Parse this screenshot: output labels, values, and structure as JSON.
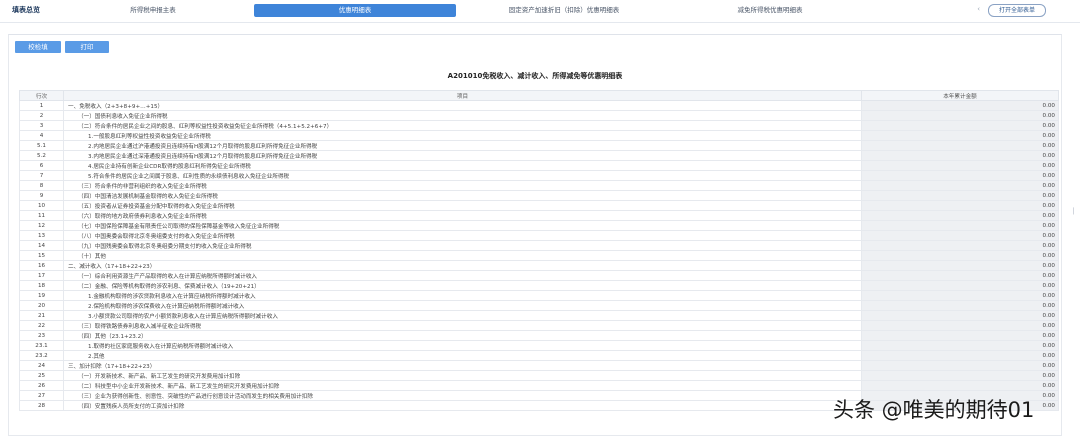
{
  "header": {
    "title": "填表总览",
    "tabs": [
      {
        "label": "所得税申报主表",
        "active": false
      },
      {
        "label": "优惠明细表",
        "active": true
      },
      {
        "label": "固定资产加速折旧（扣除）优惠明细表",
        "active": false
      },
      {
        "label": "减免所得税优惠明细表",
        "active": false
      }
    ],
    "scroll_arrow": "‹",
    "open_all_label": "打开全部表单"
  },
  "toolbar": {
    "check_label": "校检填",
    "print_label": "打印"
  },
  "form": {
    "title": "A201010免税收入、减计收入、所得减免等优惠明细表",
    "columns": {
      "row_no": "行次",
      "item": "项目",
      "amount": "本年累计金额"
    },
    "rows": [
      {
        "no": "1",
        "item": "一、免税收入（2+3+8+9+…+15）",
        "amount": "0.00"
      },
      {
        "no": "2",
        "item": "（一）国债利息收入免征企业所得税",
        "amount": "0.00"
      },
      {
        "no": "3",
        "item": "（二）符合条件的居民企业之间的股息、红利等权益性投资收益免征企业所得税（4+5.1+5.2+6+7）",
        "amount": "0.00"
      },
      {
        "no": "4",
        "item": "1.一般股息红利等权益性投资收益免征企业所得税",
        "amount": "0.00"
      },
      {
        "no": "5.1",
        "item": "2.内地居民企业通过沪港通投资且连续持有H股满12个月取得的股息红利所得免征企业所得税",
        "amount": "0.00"
      },
      {
        "no": "5.2",
        "item": "3.内地居民企业通过深港通投资且连续持有H股满12个月取得的股息红利所得免征企业所得税",
        "amount": "0.00"
      },
      {
        "no": "6",
        "item": "4.居民企业持有创新企业CDR取得的股息红利所得免征企业所得税",
        "amount": "0.00"
      },
      {
        "no": "7",
        "item": "5.符合条件的居民企业之间属于股息、红利性质的永续债利息收入免征企业所得税",
        "amount": "0.00"
      },
      {
        "no": "8",
        "item": "（三）符合条件的非营利组织的收入免征企业所得税",
        "amount": "0.00"
      },
      {
        "no": "9",
        "item": "（四）中国清洁发展机制基金取得的收入免征企业所得税",
        "amount": "0.00"
      },
      {
        "no": "10",
        "item": "（五）投资者从证券投资基金分配中取得的收入免征企业所得税",
        "amount": "0.00"
      },
      {
        "no": "11",
        "item": "（六）取得的地方政府债券利息收入免征企业所得税",
        "amount": "0.00"
      },
      {
        "no": "12",
        "item": "（七）中国保险保障基金有限责任公司取得的保险保障基金等收入免征企业所得税",
        "amount": "0.00"
      },
      {
        "no": "13",
        "item": "（八）中国奥委会取得北京冬奥组委支付的收入免征企业所得税",
        "amount": "0.00"
      },
      {
        "no": "14",
        "item": "（九）中国残奥委会取得北京冬奥组委分期支付的收入免征企业所得税",
        "amount": "0.00"
      },
      {
        "no": "15",
        "item": "（十）其他",
        "amount": "0.00"
      },
      {
        "no": "16",
        "item": "二、减计收入（17+18+22+23）",
        "amount": "0.00"
      },
      {
        "no": "17",
        "item": "（一）综合利用资源生产产品取得的收入在计算应纳税所得额时减计收入",
        "amount": "0.00"
      },
      {
        "no": "18",
        "item": "（二）金融、保险等机构取得的涉农利息、保费减计收入（19+20+21）",
        "amount": "0.00"
      },
      {
        "no": "19",
        "item": "1.金融机构取得的涉农贷款利息收入在计算应纳税所得额时减计收入",
        "amount": "0.00"
      },
      {
        "no": "20",
        "item": "2.保险机构取得的涉农保费收入在计算应纳税所得额时减计收入",
        "amount": "0.00"
      },
      {
        "no": "21",
        "item": "3.小额贷款公司取得的农户小额贷款利息收入在计算应纳税所得额时减计收入",
        "amount": "0.00"
      },
      {
        "no": "22",
        "item": "（三）取得铁路债券利息收入减半征收企业所得税",
        "amount": "0.00"
      },
      {
        "no": "23",
        "item": "（四）其他（23.1+23.2）",
        "amount": "0.00"
      },
      {
        "no": "23.1",
        "item": "1.取得的社区家庭服务收入在计算应纳税所得额时减计收入",
        "amount": "0.00"
      },
      {
        "no": "23.2",
        "item": "2.其他",
        "amount": "0.00"
      },
      {
        "no": "24",
        "item": "三、加计扣除（17+18+22+23）",
        "amount": "0.00"
      },
      {
        "no": "25",
        "item": "（一）开发新技术、新产品、新工艺发生的研究开发费用加计扣除",
        "amount": "0.00"
      },
      {
        "no": "26",
        "item": "（二）科技型中小企业开发新技术、新产品、新工艺发生的研究开发费用加计扣除",
        "amount": "0.00"
      },
      {
        "no": "27",
        "item": "（三）企业为获得创新性、创意性、突破性的产品进行创意设计活动而发生的相关费用加计扣除",
        "amount": "0.00"
      },
      {
        "no": "28",
        "item": "（四）安置残疾人员所支付的工资加计扣除",
        "amount": "0.00"
      }
    ]
  },
  "watermark": "头条 @唯美的期待01"
}
